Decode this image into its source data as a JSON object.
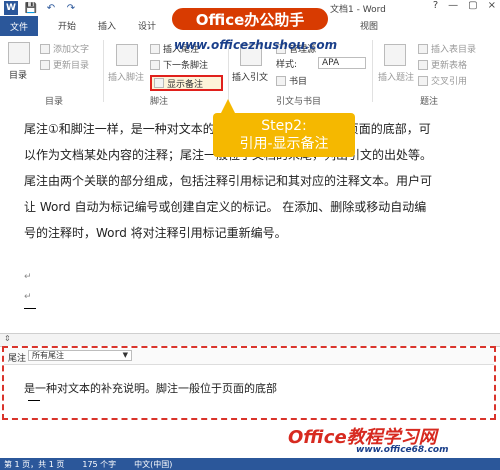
{
  "titlebar": {
    "doc_title": "文档1 - Word",
    "qat": [
      "W",
      "💾",
      "↶",
      "↷"
    ],
    "window_controls": [
      "?",
      "—",
      "▢",
      "×"
    ]
  },
  "tabs": {
    "file": "文件",
    "items": [
      "开始",
      "插入",
      "设计",
      "视图"
    ]
  },
  "banner": {
    "title": "Office办公助手",
    "url": "www.officezhushou.com"
  },
  "ribbon": {
    "toc": {
      "label": "目录",
      "add_text": "添加文字",
      "update_toc": "更新目录",
      "group": "目录"
    },
    "footnotes": {
      "insert_footnote": "插入脚注",
      "insert_endnote": "插入尾注",
      "next_footnote": "下一条脚注",
      "show_notes": "显示备注",
      "group": "脚注"
    },
    "citations": {
      "insert_citation": "插入引文",
      "manage_sources": "管理源",
      "style_label": "样式:",
      "style_value": "APA",
      "bibliography": "书目",
      "group": "引文与书目"
    },
    "captions": {
      "insert_caption": "插入题注",
      "insert_table_of_figures": "插入表目录",
      "update_table": "更新表格",
      "cross_reference": "交叉引用",
      "group": "题注"
    }
  },
  "callout": {
    "line1": "Step2:",
    "line2": "引用-显示备注"
  },
  "document": {
    "lines": [
      "尾注①和脚注一样，是一种对文本的补充说明。脚注一般位于页面的底部，可",
      "以作为文档某处内容的注释；尾注一般位于文档的末尾，列出引文的出处等。",
      "尾注由两个关联的部分组成，包括注释引用标记和其对应的注释文本。用户可",
      "让 Word 自动为标记编号或创建自定义的标记。 在添加、删除或移动自动编",
      "号的注释时，Word 将对注释引用标记重新编号。"
    ]
  },
  "notes_pane": {
    "label": "尾注",
    "filter_value": "所有尾注",
    "text": "是一种对文本的补充说明。脚注一般位于页面的底部"
  },
  "site_mark": {
    "title": "Office教程学习网",
    "url": "www.office68.com"
  },
  "statusbar": {
    "page": "第 1 页，共 1 页",
    "words": "175 个字",
    "language": "中文(中国)"
  }
}
